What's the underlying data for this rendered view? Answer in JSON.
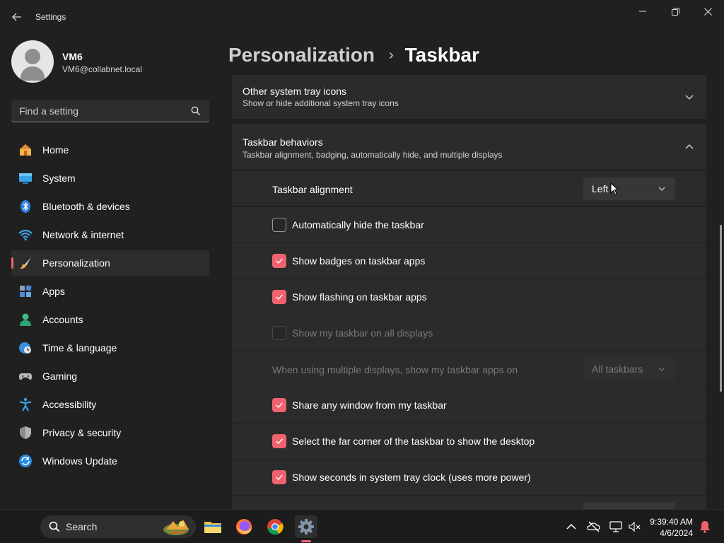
{
  "window": {
    "title": "Settings",
    "minimize_glyph": "—",
    "maximize_glyph": "❐",
    "close_glyph": "✕"
  },
  "profile": {
    "name": "VM6",
    "email": "VM6@collabnet.local"
  },
  "search": {
    "placeholder": "Find a setting"
  },
  "sidebar": {
    "items": [
      {
        "label": "Home",
        "icon": "home-icon"
      },
      {
        "label": "System",
        "icon": "system-icon"
      },
      {
        "label": "Bluetooth & devices",
        "icon": "bluetooth-icon"
      },
      {
        "label": "Network & internet",
        "icon": "wifi-icon"
      },
      {
        "label": "Personalization",
        "icon": "brush-icon",
        "active": true
      },
      {
        "label": "Apps",
        "icon": "apps-icon"
      },
      {
        "label": "Accounts",
        "icon": "accounts-icon"
      },
      {
        "label": "Time & language",
        "icon": "globe-clock-icon"
      },
      {
        "label": "Gaming",
        "icon": "gamepad-icon"
      },
      {
        "label": "Accessibility",
        "icon": "accessibility-icon"
      },
      {
        "label": "Privacy & security",
        "icon": "shield-icon"
      },
      {
        "label": "Windows Update",
        "icon": "update-icon"
      }
    ]
  },
  "breadcrumb": {
    "parent": "Personalization",
    "separator": "›",
    "current": "Taskbar"
  },
  "sections": {
    "tray_icons": {
      "title": "Other system tray icons",
      "subtitle": "Show or hide additional system tray icons",
      "expanded": false
    },
    "behaviors": {
      "title": "Taskbar behaviors",
      "subtitle": "Taskbar alignment, badging, automatically hide, and multiple displays",
      "expanded": true
    }
  },
  "settings": {
    "alignment": {
      "label": "Taskbar alignment",
      "value": "Left"
    },
    "auto_hide": {
      "label": "Automatically hide the taskbar",
      "checked": false
    },
    "badges": {
      "label": "Show badges on taskbar apps",
      "checked": true
    },
    "flashing": {
      "label": "Show flashing on taskbar apps",
      "checked": true
    },
    "all_displays": {
      "label": "Show my taskbar on all displays",
      "checked": false,
      "disabled": true
    },
    "multi_display_apps": {
      "label": "When using multiple displays, show my taskbar apps on",
      "value": "All taskbars",
      "disabled": true
    },
    "share_window": {
      "label": "Share any window from my taskbar",
      "checked": true
    },
    "far_corner": {
      "label": "Select the far corner of the taskbar to show the desktop",
      "checked": true
    },
    "seconds": {
      "label": "Show seconds in system tray clock (uses more power)",
      "checked": true
    }
  },
  "taskbar": {
    "search_label": "Search",
    "apps": [
      "file-explorer-icon",
      "firefox-icon",
      "chrome-icon",
      "settings-icon"
    ],
    "clock_time": "9:39:40 AM",
    "clock_date": "4/6/2024"
  },
  "colors": {
    "accent": "#f0626e",
    "background": "#202020",
    "card": "#2b2b2b"
  }
}
